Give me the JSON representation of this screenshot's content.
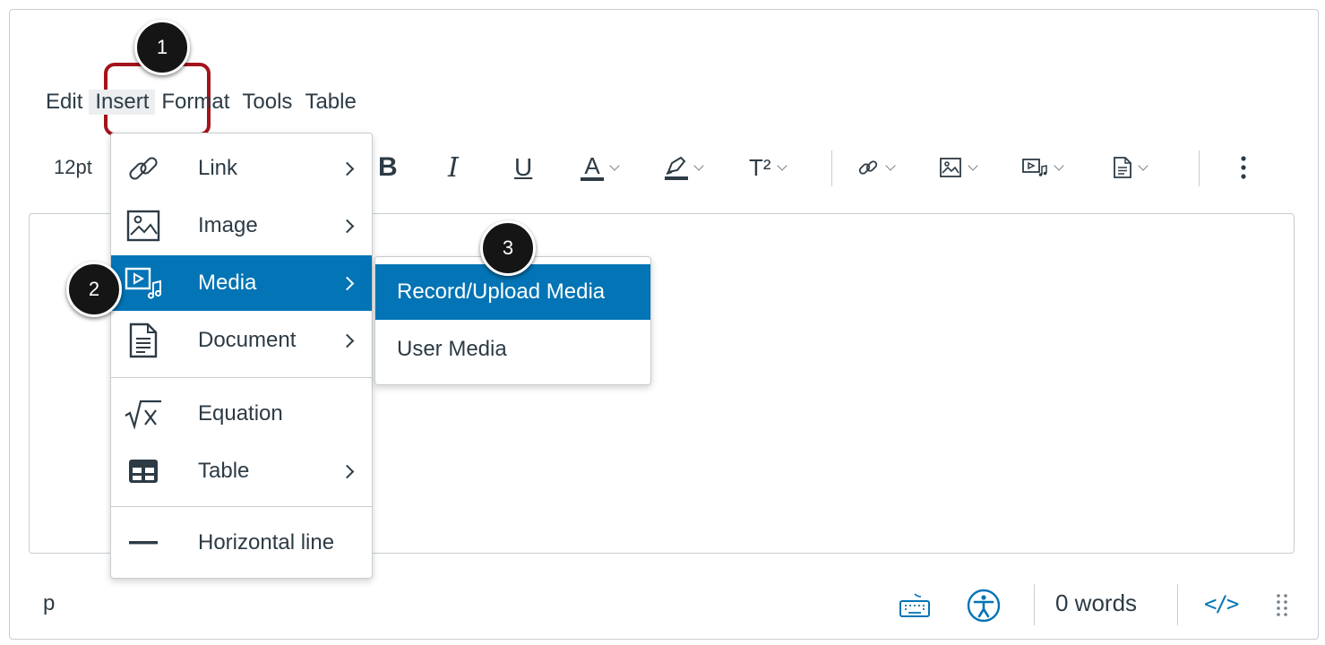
{
  "menubar": {
    "items": [
      "Edit",
      "Insert",
      "Format",
      "Tools",
      "Table"
    ]
  },
  "toolbar": {
    "font_size": "12pt",
    "bold": "B",
    "italic": "I",
    "underline": "U",
    "text_color": "A",
    "superscript": "T²"
  },
  "insert_menu": {
    "items": [
      {
        "label": "Link",
        "icon": "link-icon",
        "has_submenu": true
      },
      {
        "label": "Image",
        "icon": "image-icon",
        "has_submenu": true
      },
      {
        "label": "Media",
        "icon": "media-icon",
        "has_submenu": true,
        "active": true
      },
      {
        "label": "Document",
        "icon": "document-icon",
        "has_submenu": true
      },
      {
        "label": "Equation",
        "icon": "equation-icon",
        "has_submenu": false
      },
      {
        "label": "Table",
        "icon": "table-icon",
        "has_submenu": true
      },
      {
        "label": "Horizontal line",
        "icon": "horizontal-line-icon",
        "has_submenu": false
      }
    ]
  },
  "media_submenu": {
    "items": [
      "Record/Upload Media",
      "User Media"
    ]
  },
  "status": {
    "element_path": "p",
    "word_count": "0 words",
    "html_toggle": "</>"
  },
  "steps": [
    "1",
    "2",
    "3"
  ],
  "colors": {
    "accent": "#0374b5",
    "highlight_border": "#a3141c",
    "text": "#2d3b45",
    "badge": "#151515"
  }
}
